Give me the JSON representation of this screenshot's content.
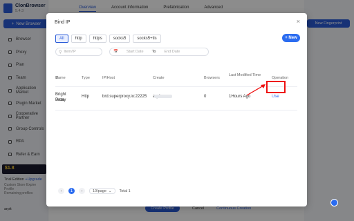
{
  "app": {
    "name": "ClonBrowser",
    "version": "5.4.3",
    "new_browser_label": "New Browser",
    "nav": [
      "Browser",
      "Proxy",
      "Plan",
      "Team",
      "Application Market",
      "Plugin Market",
      "Cooperative Partner",
      "Group Controls",
      "RPA",
      "Refer & Earn"
    ],
    "promo_price": "$1.8",
    "trial_label": "Trial Edition",
    "upgrade_label": "+Upgrade",
    "trial_lines": [
      "Custom Store Expire",
      "Profile",
      "Remaining profiles"
    ],
    "user_name": "arpit"
  },
  "main": {
    "tabs": [
      "Overview",
      "Account Information",
      "Prefabrication",
      "Advanced"
    ],
    "new_fingerprint_label": "New Fingerprint",
    "create_profile_label": "Create Profile",
    "cancel_label": "Cancel",
    "continuous_creation_label": "Continuous Creation"
  },
  "modal": {
    "title": "Bind IP",
    "close_glyph": "×",
    "protocol_tabs": [
      "All",
      "http",
      "https",
      "socks5",
      "socks5+tls"
    ],
    "active_protocol": "All",
    "new_label": "+ New",
    "search_placeholder": "Item/IP",
    "date_start_placeholder": "Start Date",
    "date_to_label": "To",
    "date_end_placeholder": "End Date",
    "columns": [
      "Name",
      "Type",
      "IP/Host",
      "Create",
      "Browsers",
      "Last Modified Time",
      "Operation"
    ],
    "rows": [
      {
        "name_line1": "Bright Data",
        "name_line2": "Proxy",
        "type": "Http",
        "host": "brd.superproxy.io:22225",
        "creator": "arpit",
        "browsers": "0",
        "modified": "1Hours Ago",
        "operation": "Use"
      }
    ],
    "pagination": {
      "current_page": "1",
      "page_size": "10/page",
      "total": "Total 1"
    }
  },
  "colors": {
    "accent": "#2b6cf0",
    "highlight": "#e11111"
  }
}
